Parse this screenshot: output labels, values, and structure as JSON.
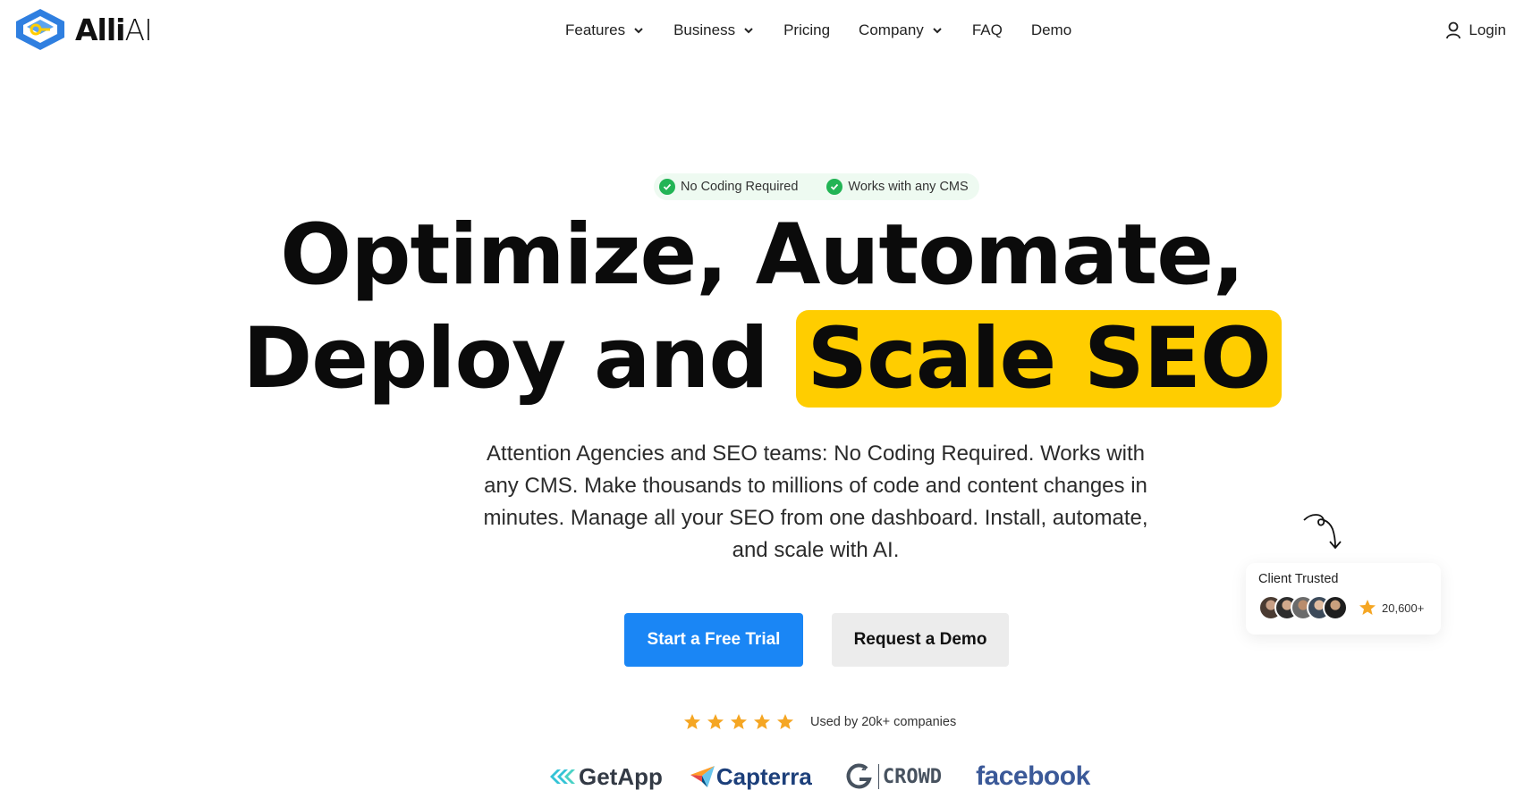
{
  "brand": {
    "name_bold": "Alli",
    "name_light": "AI",
    "colors": {
      "logo_blue": "#2f7fe0",
      "logo_yellow": "#ffcd00"
    }
  },
  "nav": {
    "items": [
      {
        "label": "Features",
        "dropdown": true
      },
      {
        "label": "Business",
        "dropdown": true
      },
      {
        "label": "Pricing",
        "dropdown": false
      },
      {
        "label": "Company",
        "dropdown": true
      },
      {
        "label": "FAQ",
        "dropdown": false
      },
      {
        "label": "Demo",
        "dropdown": false
      }
    ],
    "login_label": "Login",
    "login_icon": "user-icon"
  },
  "badges": [
    {
      "label": "No Coding Required",
      "icon": "check-circle-icon"
    },
    {
      "label": "Works with any CMS",
      "icon": "check-circle-icon"
    }
  ],
  "hero": {
    "line1": "Optimize, Automate,",
    "line2_plain": "Deploy and",
    "line2_highlight": "Scale SEO",
    "highlight_color": "#ffcd00",
    "subtext": "Attention Agencies and SEO teams: No Coding Required. Works with any CMS. Make thousands to millions of code and content changes in minutes. Manage all your SEO from one dashboard. Install, automate, and scale with AI."
  },
  "cta": {
    "primary_label": "Start a Free Trial",
    "secondary_label": "Request a Demo",
    "primary_color": "#1a86f5"
  },
  "social_proof": {
    "star_count": 5,
    "star_color": "#f5a623",
    "used_by": "Used by 20k+ companies"
  },
  "review_logos": [
    {
      "name": "GetApp",
      "icon": "getapp-logo-icon"
    },
    {
      "name": "Capterra",
      "icon": "capterra-logo-icon"
    },
    {
      "name": "CROWD",
      "icon": "g2-crowd-logo-icon"
    },
    {
      "name": "facebook",
      "icon": "facebook-logo-icon"
    }
  ],
  "client_card": {
    "title": "Client Trusted",
    "count": "20,600+",
    "avatar_count": 5
  }
}
